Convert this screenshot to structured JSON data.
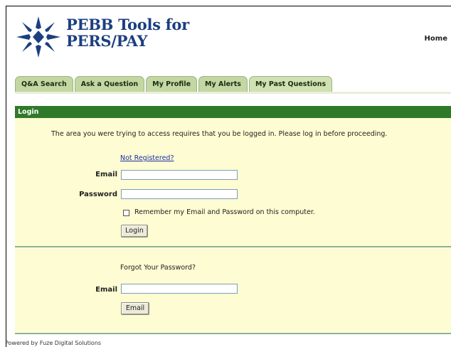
{
  "brand": {
    "line1": "PEBB Tools for",
    "line2": "PERS/PAY"
  },
  "nav": {
    "home": "Home"
  },
  "tabs": [
    {
      "label": "Q&A Search"
    },
    {
      "label": "Ask a Question"
    },
    {
      "label": "My Profile"
    },
    {
      "label": "My Alerts"
    },
    {
      "label": "My Past Questions"
    }
  ],
  "login": {
    "header": "Login",
    "message": "The area you were trying to access requires that you be logged in. Please log in before proceeding.",
    "register_link": "Not Registered?",
    "email_label": "Email",
    "email_value": "",
    "password_label": "Password",
    "password_value": "",
    "remember_label": "Remember my Email and Password on this computer.",
    "remember_checked": false,
    "button": "Login"
  },
  "forgot": {
    "title": "Forgot Your Password?",
    "email_label": "Email",
    "email_value": "",
    "button": "Email"
  },
  "footer": "Powered by Fuze Digital Solutions",
  "colors": {
    "brand": "#1d3f80",
    "header_green": "#2f7a2a",
    "tab_green": "#c3d7a3",
    "panel_yellow": "#fdfcd2"
  }
}
